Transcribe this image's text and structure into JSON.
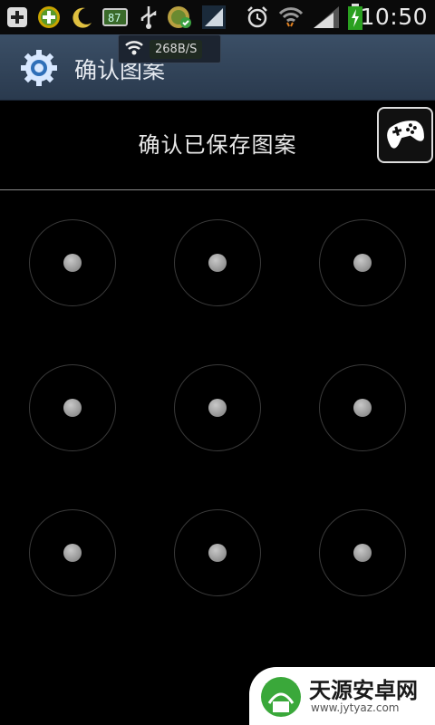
{
  "status_bar": {
    "time": "10:50",
    "icons": [
      "add-icon",
      "plus-badge-icon",
      "moon-icon",
      "battery-app-icon",
      "usb-icon",
      "app-check-icon",
      "signal-app-icon",
      "alarm-icon",
      "wifi-icon",
      "cell-signal-icon",
      "battery-charging-icon"
    ],
    "netspeed": "268B/S"
  },
  "action_bar": {
    "title": "确认图案"
  },
  "screen": {
    "prompt": "确认已保存图案",
    "game_button_icon": "gamepad-icon"
  },
  "pattern": {
    "rows": 3,
    "cols": 3,
    "selected": []
  },
  "watermark": {
    "brand": "天源安卓网",
    "url": "www.jytyaz.com"
  }
}
